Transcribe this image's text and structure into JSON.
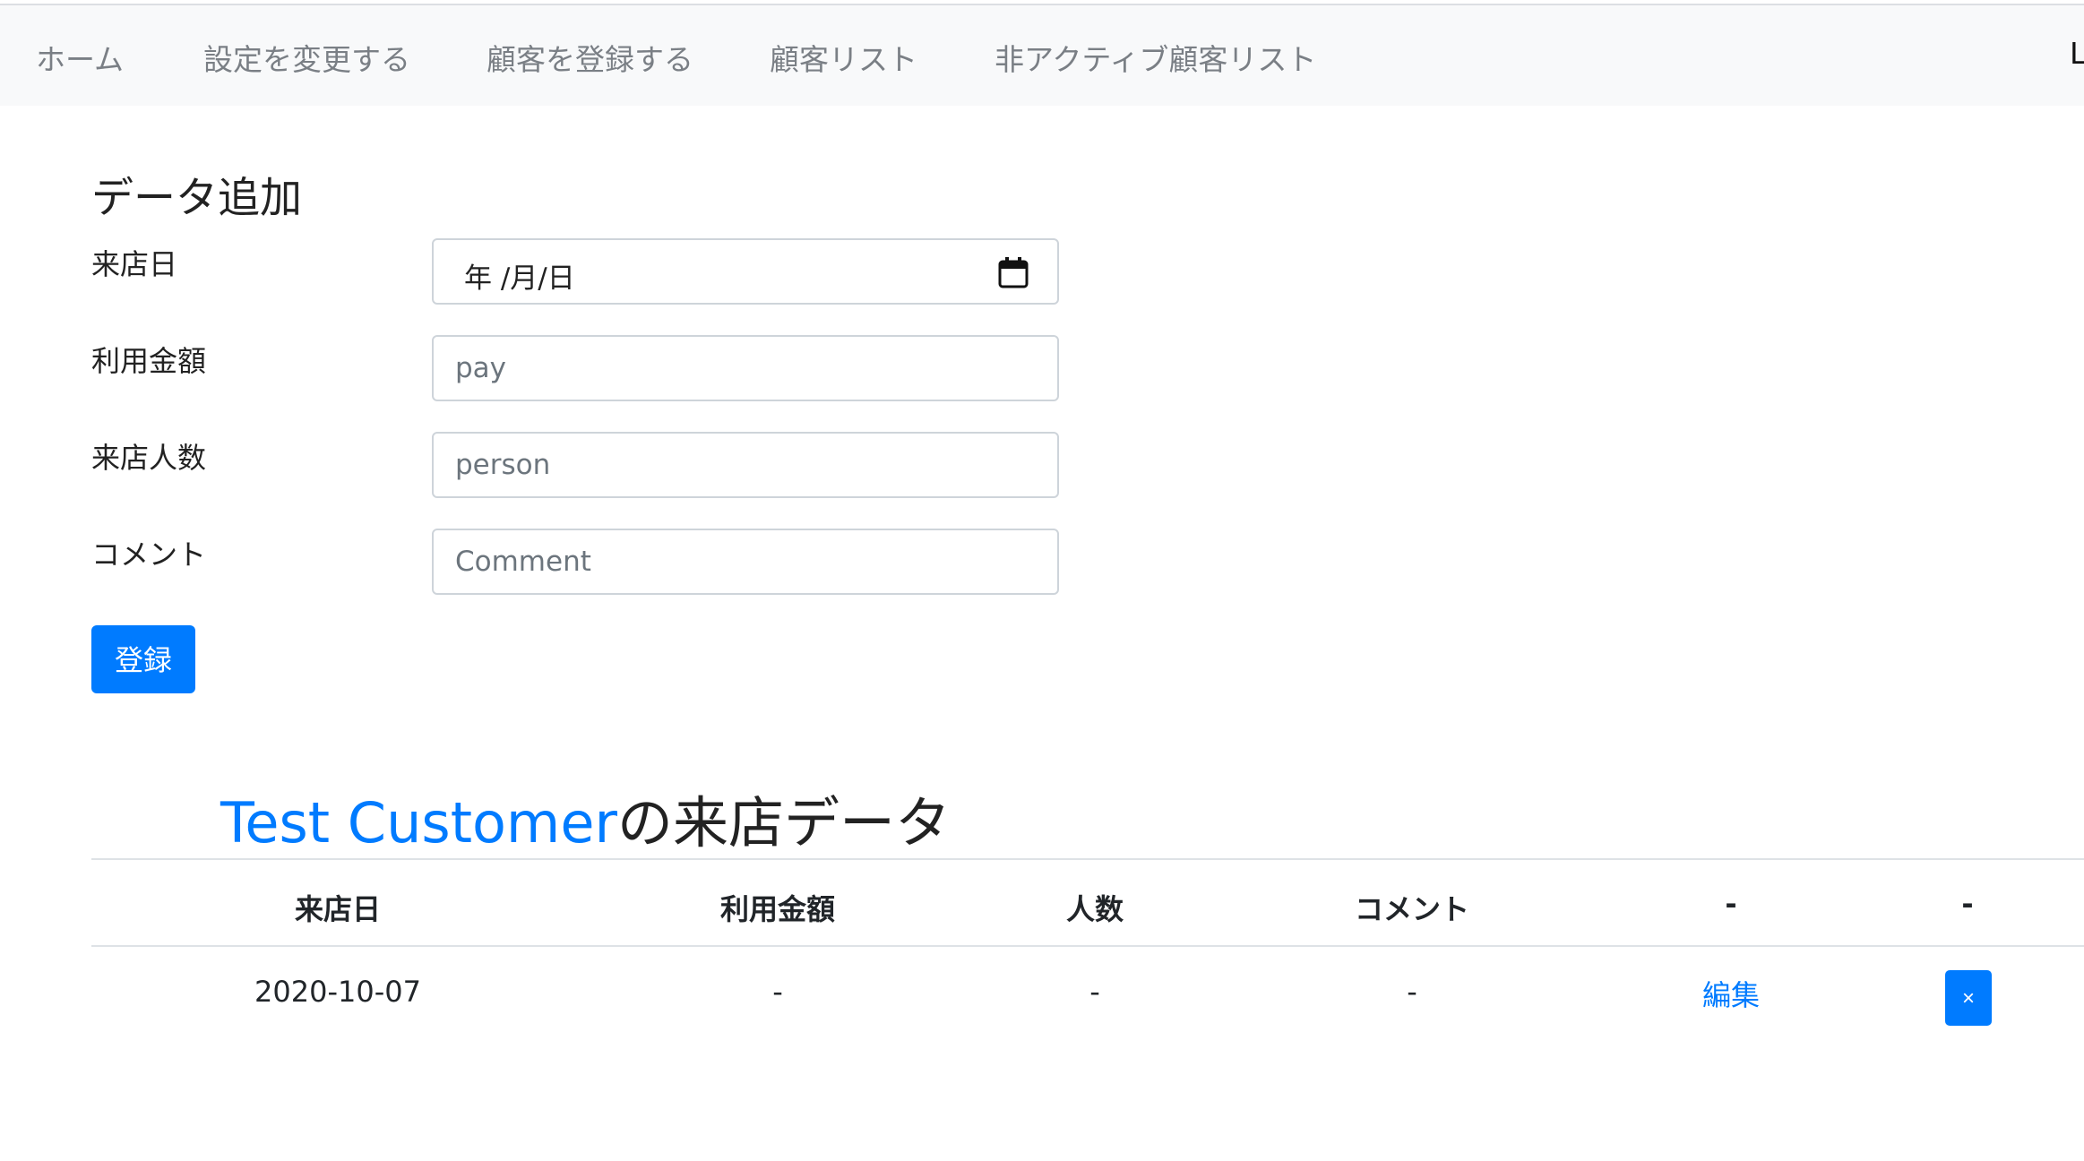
{
  "navbar": {
    "items": [
      {
        "label": "ホーム"
      },
      {
        "label": "設定を変更する"
      },
      {
        "label": "顧客を登録する"
      },
      {
        "label": "顧客リスト"
      },
      {
        "label": "非アクティブ顧客リスト"
      }
    ],
    "right_text": "L"
  },
  "form": {
    "title": "データ追加",
    "fields": [
      {
        "label": "来店日",
        "display_value": "年 /月/日"
      },
      {
        "label": "利用金額",
        "placeholder": "pay"
      },
      {
        "label": "来店人数",
        "placeholder": "person"
      },
      {
        "label": "コメント",
        "placeholder": "Comment"
      }
    ],
    "submit_label": "登録"
  },
  "visits": {
    "customer_name": "Test Customer",
    "title_suffix": "の来店データ",
    "columns": [
      "来店日",
      "利用金額",
      "人数",
      "コメント",
      "-",
      "-"
    ],
    "rows": [
      {
        "date": "2020-10-07",
        "amount": "-",
        "people": "-",
        "comment": "-",
        "edit_label": "編集",
        "delete_label": "×"
      }
    ]
  },
  "colors": {
    "accent": "#007bff",
    "navbar_bg": "#f8f9fa",
    "nav_text": "#7a7f85",
    "border": "#ced4da"
  }
}
